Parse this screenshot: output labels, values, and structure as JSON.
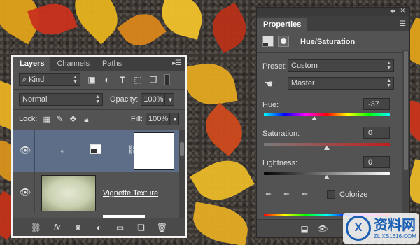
{
  "layers_panel": {
    "tabs": [
      {
        "label": "Layers",
        "active": true
      },
      {
        "label": "Channels",
        "active": false
      },
      {
        "label": "Paths",
        "active": false
      }
    ],
    "filter_kind": "Kind",
    "blend_mode": "Normal",
    "opacity_label": "Opacity:",
    "opacity_value": "100%",
    "lock_label": "Lock:",
    "fill_label": "Fill:",
    "fill_value": "100%",
    "layers": [
      {
        "name": "",
        "type": "adjustment-hue-saturation",
        "selected": true,
        "visible": true
      },
      {
        "name": "Vignette Texture",
        "type": "image",
        "selected": false,
        "visible": true
      }
    ],
    "footer_icons": [
      "link-icon",
      "fx-icon",
      "mask-icon",
      "adjustment-icon",
      "folder-icon",
      "new-layer-icon",
      "trash-icon"
    ],
    "fx_label": "fx"
  },
  "properties_panel": {
    "title": "Properties",
    "adjustment_title": "Hue/Saturation",
    "preset_label": "Preset:",
    "preset_value": "Custom",
    "channel_value": "Master",
    "hue_label": "Hue:",
    "hue_value": "-37",
    "hue_fraction": 0.4,
    "saturation_label": "Saturation:",
    "saturation_value": "0",
    "saturation_fraction": 0.5,
    "lightness_label": "Lightness:",
    "lightness_value": "0",
    "lightness_fraction": 0.5,
    "colorize_label": "Colorize",
    "colorize_checked": false
  },
  "watermark": {
    "text": "资料网",
    "subtext": "ZL.XS1616.COM"
  },
  "colors": {
    "panel_bg": "#535353",
    "selected_layer": "#5f6e88",
    "watermark_blue": "#1a5fb4"
  }
}
